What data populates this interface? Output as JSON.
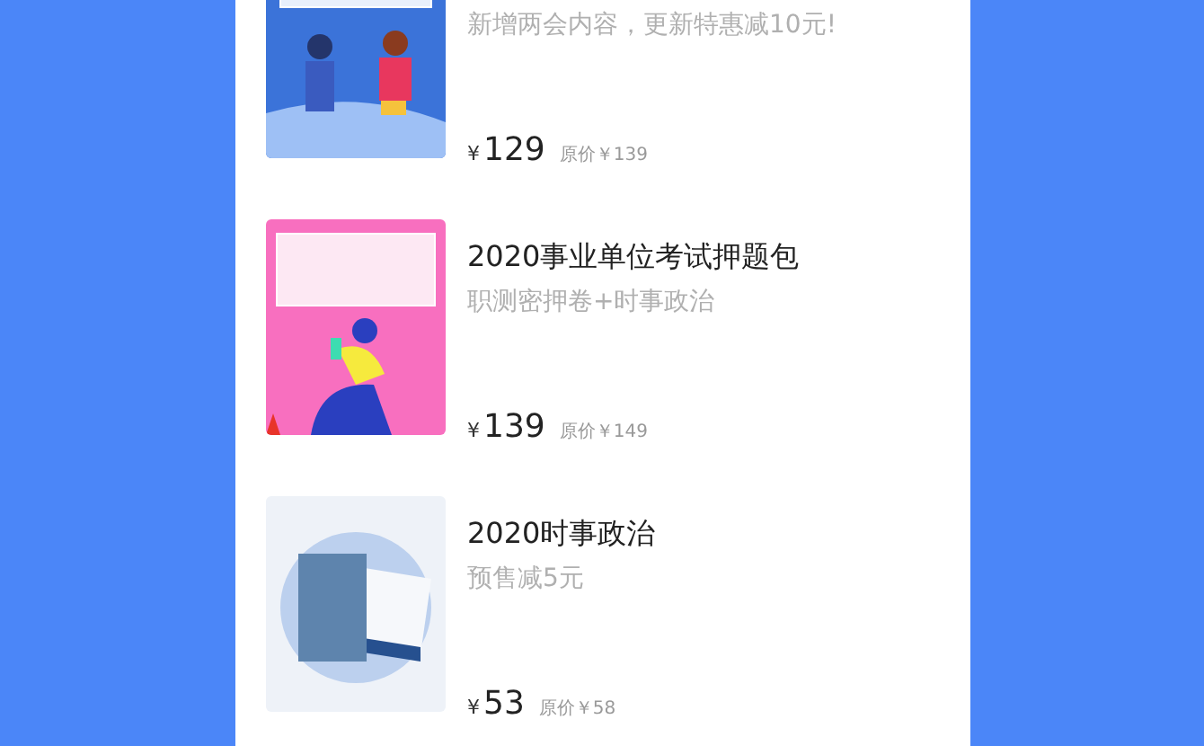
{
  "products": [
    {
      "subtitle": "新增两会内容，更新特惠减10元!",
      "currency": "¥",
      "price": "129",
      "original_price": "原价￥139"
    },
    {
      "title": "2020事业单位考试押题包",
      "subtitle": "职测密押卷+时事政治",
      "currency": "¥",
      "price": "139",
      "original_price": "原价￥149"
    },
    {
      "title": "2020时事政治",
      "subtitle": "预售减5元",
      "currency": "¥",
      "price": "53",
      "original_price": "原价￥58"
    }
  ]
}
